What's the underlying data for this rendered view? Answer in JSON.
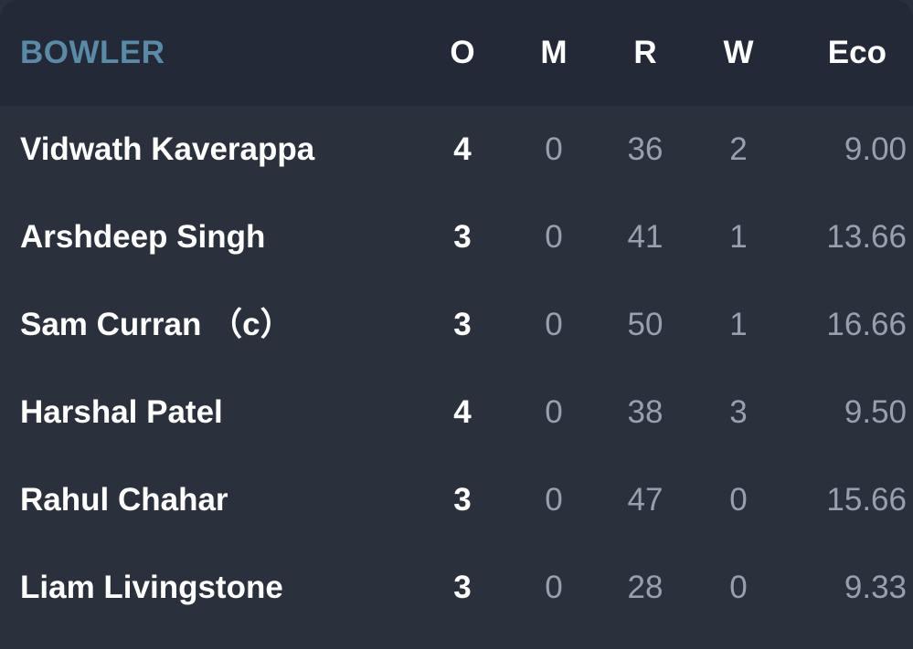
{
  "header": {
    "bowler": "BOWLER",
    "overs": "O",
    "maidens": "M",
    "runs": "R",
    "wickets": "W",
    "economy": "Eco"
  },
  "rows": [
    {
      "name": "Vidwath Kaverappa",
      "o": "4",
      "m": "0",
      "r": "36",
      "w": "2",
      "eco": "9.00"
    },
    {
      "name": "Arshdeep Singh",
      "o": "3",
      "m": "0",
      "r": "41",
      "w": "1",
      "eco": "13.66"
    },
    {
      "name": "Sam Curran （c）",
      "o": "3",
      "m": "0",
      "r": "50",
      "w": "1",
      "eco": "16.66"
    },
    {
      "name": "Harshal Patel",
      "o": "4",
      "m": "0",
      "r": "38",
      "w": "3",
      "eco": "9.50"
    },
    {
      "name": "Rahul Chahar",
      "o": "3",
      "m": "0",
      "r": "47",
      "w": "0",
      "eco": "15.66"
    },
    {
      "name": "Liam Livingstone",
      "o": "3",
      "m": "0",
      "r": "28",
      "w": "0",
      "eco": "9.33"
    }
  ]
}
